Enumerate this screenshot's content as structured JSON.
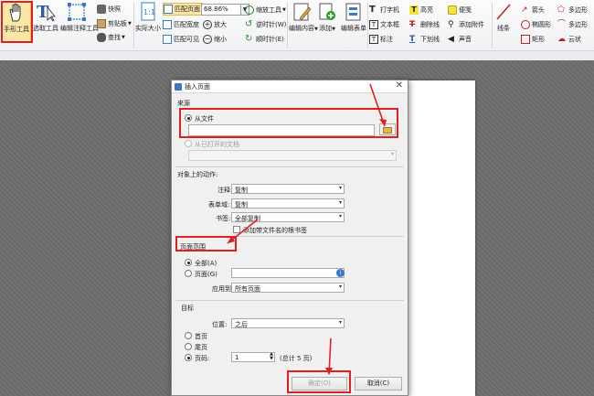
{
  "ribbon": {
    "hand_tool": "手形工具",
    "select_tool": "选取工具",
    "annot_select_tool": "编辑注释工具",
    "snapshot": "快照",
    "clipboard": "剪贴板",
    "find": "查找",
    "actual_size": "实际大小",
    "fit_page": "匹配页面",
    "fit_width": "匹配宽度",
    "fit_visible": "匹配可见",
    "zoom_value": "68.86%",
    "zoom_in": "放大",
    "zoom_out": "缩小",
    "zoom_tool": "缩放工具",
    "rotate_left": "逆时针(W)",
    "rotate_right": "顺时针(E)",
    "edit_content": "编辑内容",
    "add": "添加",
    "edit_form": "编辑表单",
    "typewriter": "打字机",
    "textbox": "文本框",
    "callout": "标注",
    "highlight": "高亮",
    "strikeout": "删除线",
    "underline": "下划线",
    "note": "便笺",
    "attach_file": "添加附件",
    "sound": "声音",
    "line": "线条",
    "arrow": "箭头",
    "ellipse": "椭圆形",
    "rectangle": "矩形",
    "polygon": "多边形",
    "polyline": "多边形",
    "cloud": "云状"
  },
  "dialog": {
    "title": "插入页面",
    "source_label": "来源",
    "from_file": "从文件",
    "file_path": "",
    "from_open_doc": "从已打开的文档",
    "action_label": "对象上的动作:",
    "annot_label": "注释:",
    "annot_value": "复制",
    "form_label": "表单域:",
    "form_value": "复制",
    "bookmark_label": "书签:",
    "bookmark_value": "全部复制",
    "add_bookmark": "添加带文件名的根书签",
    "page_range_label": "页面范围",
    "all": "全部(A)",
    "pages": "页面(G)",
    "apply_label": "应用到:",
    "apply_value": "所有页面",
    "target_label": "目标",
    "position_label": "位置:",
    "position_value": "之后",
    "first_page": "首页",
    "last_page": "尾页",
    "page_label": "页码:",
    "page_value": "1",
    "total": "(总计 5 页)",
    "ok": "确定(O)",
    "cancel": "取消(C)"
  },
  "colors": {
    "highlight_red": "#e02020",
    "accent_blue": "#3a79c4"
  }
}
